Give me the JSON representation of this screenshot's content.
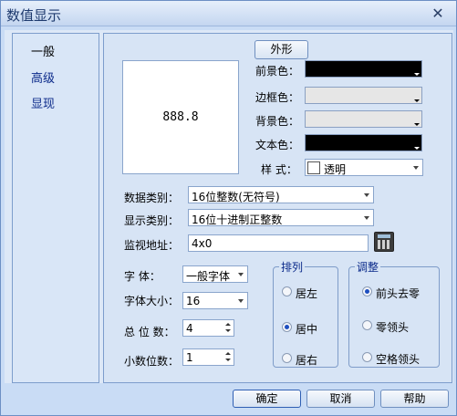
{
  "window": {
    "title": "数值显示",
    "close_glyph": "✕"
  },
  "sidebar": {
    "items": [
      "一般",
      "高级",
      "显现"
    ]
  },
  "main": {
    "tab_label": "外形",
    "preview_value": "888.8",
    "colors": {
      "foreground_label": "前景色：",
      "border_label": "边框色：",
      "background_label": "背景色：",
      "text_label": "文本色：",
      "foreground_value": "#000000",
      "border_value": "#e6e6e6",
      "background_value": "#e6e6e6",
      "text_value": "#000000"
    },
    "style": {
      "label": "样 式：",
      "value": "透明"
    },
    "data_type": {
      "label": "数据类别：",
      "value": "16位整数(无符号)"
    },
    "display_type": {
      "label": "显示类别：",
      "value": "16位十进制正整数"
    },
    "monitor_addr": {
      "label": "监视地址：",
      "value": "4x0"
    },
    "font": {
      "label": "字    体：",
      "value": "一般字体"
    },
    "font_size": {
      "label": "字体大小：",
      "value": "16"
    },
    "total_digits": {
      "label": "总 位 数：",
      "value": "4"
    },
    "decimal_digits": {
      "label": "小数位数：",
      "value": "1"
    },
    "align_group": {
      "legend": "排列",
      "options": [
        "居左",
        "居中",
        "居右"
      ],
      "selected": "居中"
    },
    "adjust_group": {
      "legend": "调整",
      "options": [
        "前头去零",
        "零领头",
        "空格领头"
      ],
      "selected": "前头去零"
    }
  },
  "footer": {
    "ok": "确定",
    "cancel": "取消",
    "help": "帮助"
  }
}
